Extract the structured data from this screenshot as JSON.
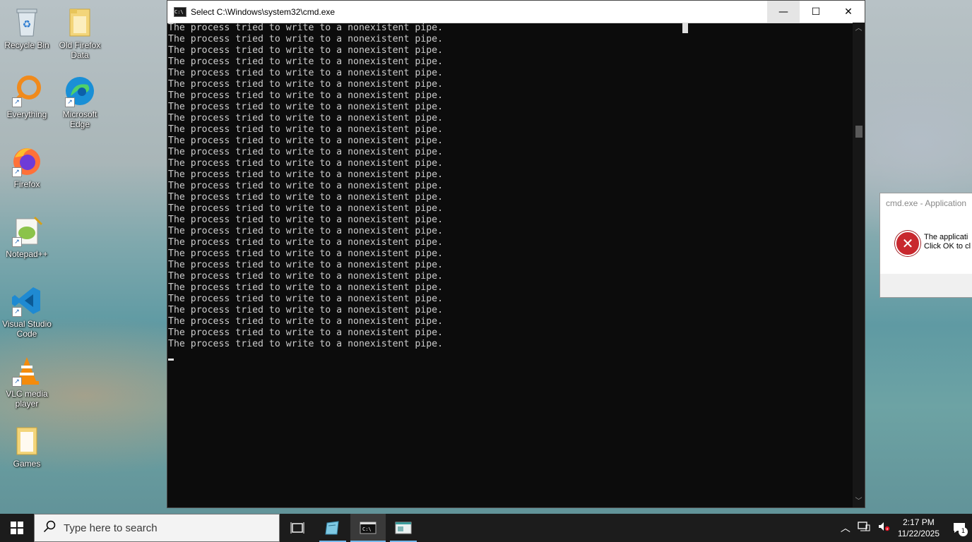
{
  "desktop": {
    "icons": [
      {
        "label": "Recycle Bin",
        "icon": "recycle-bin-icon"
      },
      {
        "label": "Old Firefox Data",
        "icon": "folder-icon"
      },
      {
        "label": "Everything",
        "icon": "everything-search-icon"
      },
      {
        "label": "Microsoft Edge",
        "icon": "edge-icon"
      },
      {
        "label": "Firefox",
        "icon": "firefox-icon"
      },
      {
        "label": "Notepad++",
        "icon": "notepadpp-icon"
      },
      {
        "label": "Visual Studio Code",
        "icon": "vscode-icon"
      },
      {
        "label": "VLC media player",
        "icon": "vlc-icon"
      },
      {
        "label": "Games",
        "icon": "folder-icon"
      }
    ]
  },
  "cmd": {
    "title": "Select C:\\Windows\\system32\\cmd.exe",
    "line_text": "The process tried to write to a nonexistent pipe.",
    "line_count": 29,
    "minimize": "—",
    "maximize": "☐",
    "close": "✕"
  },
  "dialog": {
    "title": "cmd.exe - Application",
    "message_line1": "The applicati",
    "message_line2": "Click OK to cl"
  },
  "taskbar": {
    "search_placeholder": "Type here to search",
    "time": "2:17 PM",
    "date": "11/22/2025",
    "notification_count": "1"
  },
  "colors": {
    "console_bg": "#0c0c0c",
    "console_text": "#cccccc",
    "taskbar_bg": "#1c1c1c",
    "accent": "#76b9ed",
    "error_red": "#c8282e"
  }
}
